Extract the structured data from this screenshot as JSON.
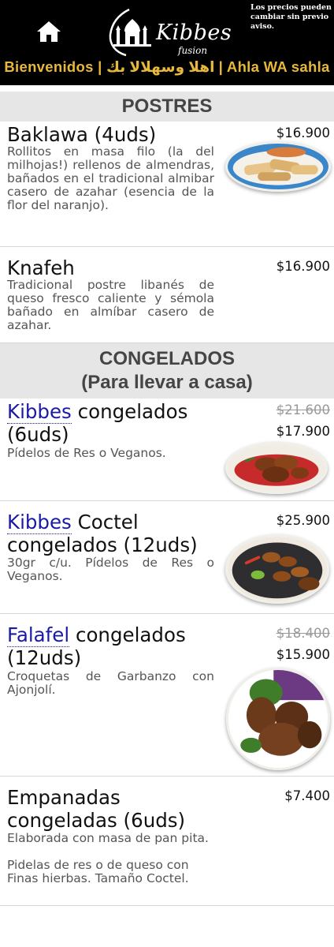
{
  "header": {
    "brand": "Kibbes",
    "brand_sub": "fusion",
    "notice": "Los precios pueden cambiar sin previo aviso.",
    "welcome": "Bienvenidos | اهلا وسهلالا بك | Ahla WA sahla",
    "home_icon": "home-icon",
    "accent_color": "#e8b83a"
  },
  "sections": [
    {
      "title": "POSTRES",
      "items": [
        {
          "name": "Baklawa (4uds)",
          "description": "Rollitos en masa filo (la del milhojas!) rellenos de almendras, bañados en el tradicional almibar casero de azahar (esencia de la flor del naranjo).",
          "price": "$16.900"
        },
        {
          "name": "Knafeh",
          "description": "Tradicional postre libanés de queso fresco caliente y sémola bañado en almíbar casero de azahar.",
          "price": "$16.900"
        }
      ]
    },
    {
      "title_line1": "CONGELADOS",
      "title_line2": "(Para llevar a casa)",
      "items": [
        {
          "name_link": "Kibbes",
          "name_rest": " congelados (6uds)",
          "description": "Pídelos de Res o Veganos.",
          "old_price": "$21.600",
          "price": "$17.900"
        },
        {
          "name_link": "Kibbes",
          "name_rest": " Coctel congelados (12uds)",
          "description": "30gr c/u. Pídelos de Res o Veganos.",
          "price": "$25.900"
        },
        {
          "name_link": "Falafel",
          "name_rest": " congelados (12uds)",
          "description": "Croquetas de Garbanzo con Ajonjolí.",
          "old_price": "$18.400",
          "price": "$15.900"
        },
        {
          "name": "Empanadas congeladas (6uds)",
          "description_line1": "Elaborada con masa de pan pita.",
          "description_line2": "Pidelas de res o de queso con Finas hierbas. Tamaño Coctel.",
          "price": "$7.400"
        }
      ]
    }
  ]
}
